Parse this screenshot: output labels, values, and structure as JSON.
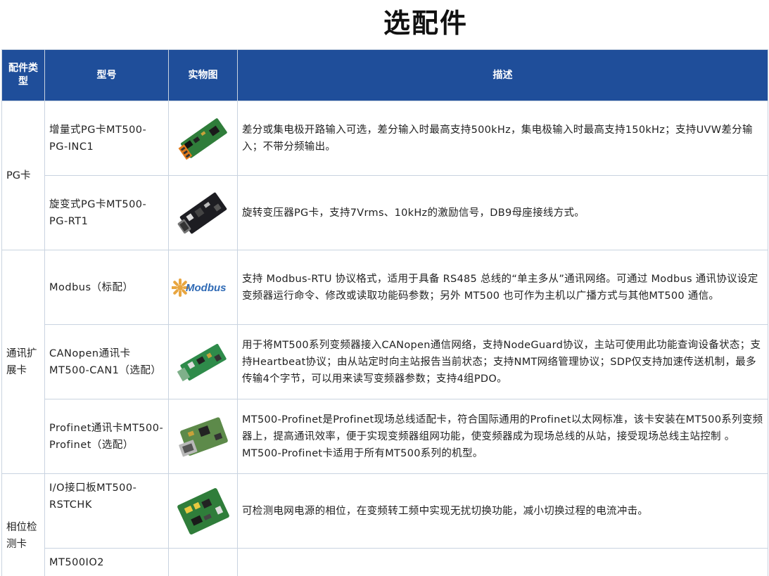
{
  "title": "选配件",
  "header": {
    "category": "配件类型",
    "model": "型号",
    "photo": "实物图",
    "description": "描述"
  },
  "categories": {
    "pg": "PG卡",
    "comm": "通讯扩展卡",
    "phase": "相位检测卡"
  },
  "rows": [
    {
      "model": "增量式PG卡MT500-PG-INC1",
      "description": "差分或集电极开路输入可选，差分输入时最高支持500kHz，集电极输入时最高支持150kHz；支持UVW差分输入；不带分频输出。"
    },
    {
      "model": "旋变式PG卡MT500-PG-RT1",
      "description": "旋转变压器PG卡，支持7Vrms、10kHz的激励信号，DB9母座接线方式。"
    },
    {
      "model": "Modbus（标配）",
      "logo": "Modbus",
      "description": "支持 Modbus-RTU 协议格式，适用于具备 RS485 总线的“单主多从”通讯网络。可通过 Modbus 通讯协议设定变频器运行命令、修改或读取功能码参数；另外 MT500 也可作为主机以广播方式与其他MT500 通信。"
    },
    {
      "model": "CANopen通讯卡MT500-CAN1（选配）",
      "description": "用于将MT500系列变频器接入CANopen通信网络，支持NodeGuard协议，主站可使用此功能查询设备状态；支持Heartbeat协议；由从站定时向主站报告当前状态；支持NMT网络管理协议；SDP仅支持加速传送机制，最多传输4个字节，可以用来读写变频器参数；支持4组PDO。"
    },
    {
      "model": "Profinet通讯卡MT500-Profinet（选配）",
      "description": "MT500-Profinet是Profinet现场总线适配卡，符合国际通用的Profinet以太网标准，该卡安装在MT500系列变频器上，提高通讯效率，便于实现变频器组网功能，使变频器成为现场总线的从站，接受现场总线主站控制 。MT500-Profinet卡适用于所有MT500系列的机型。"
    },
    {
      "model": "I/O接口板MT500-RSTCHK",
      "description": "可检测电网电源的相位，在变频转工频中实现无扰切换功能，减小切换过程的电流冲击。"
    },
    {
      "model": "MT500IO2",
      "description": ""
    }
  ]
}
